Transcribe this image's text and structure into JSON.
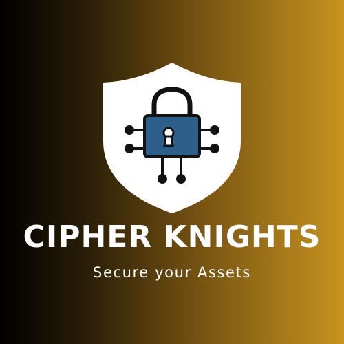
{
  "brand": {
    "name": "CIPHER KNIGHTS",
    "tagline": "Secure your Assets"
  },
  "emblem": {
    "shield_icon": "shield-icon",
    "lock_icon": "padlock-icon",
    "keyhole_icon": "keyhole-icon",
    "circuit_icon": "circuit-traces-icon"
  },
  "colors": {
    "background_start": "#000000",
    "background_end": "#c8941f",
    "shield": "#ffffff",
    "lock_body": "#2e5f8a",
    "lines": "#111111",
    "text": "#ffffff"
  }
}
